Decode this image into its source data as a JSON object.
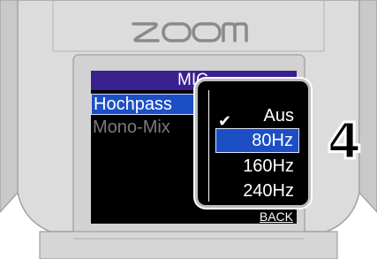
{
  "device": {
    "brand": "ZOOM"
  },
  "screen": {
    "title": "MIC",
    "menu_items": [
      {
        "label": "Hochpass",
        "selected": true
      },
      {
        "label": "Mono-Mix",
        "selected": false
      }
    ],
    "back_label": "BACK"
  },
  "popup": {
    "options": [
      {
        "label": "Aus",
        "checked": true,
        "highlighted": false
      },
      {
        "label": "80Hz",
        "checked": false,
        "highlighted": true
      },
      {
        "label": "160Hz",
        "checked": false,
        "highlighted": false
      },
      {
        "label": "240Hz",
        "checked": false,
        "highlighted": false
      }
    ],
    "check_glyph": "✔"
  },
  "annotation": {
    "step_number": "4"
  },
  "colors": {
    "device_body": "#dcdcdc",
    "device_outline": "#9a9a9a",
    "screen_header": "#3a1f8f",
    "selection": "#1c4fc4"
  }
}
